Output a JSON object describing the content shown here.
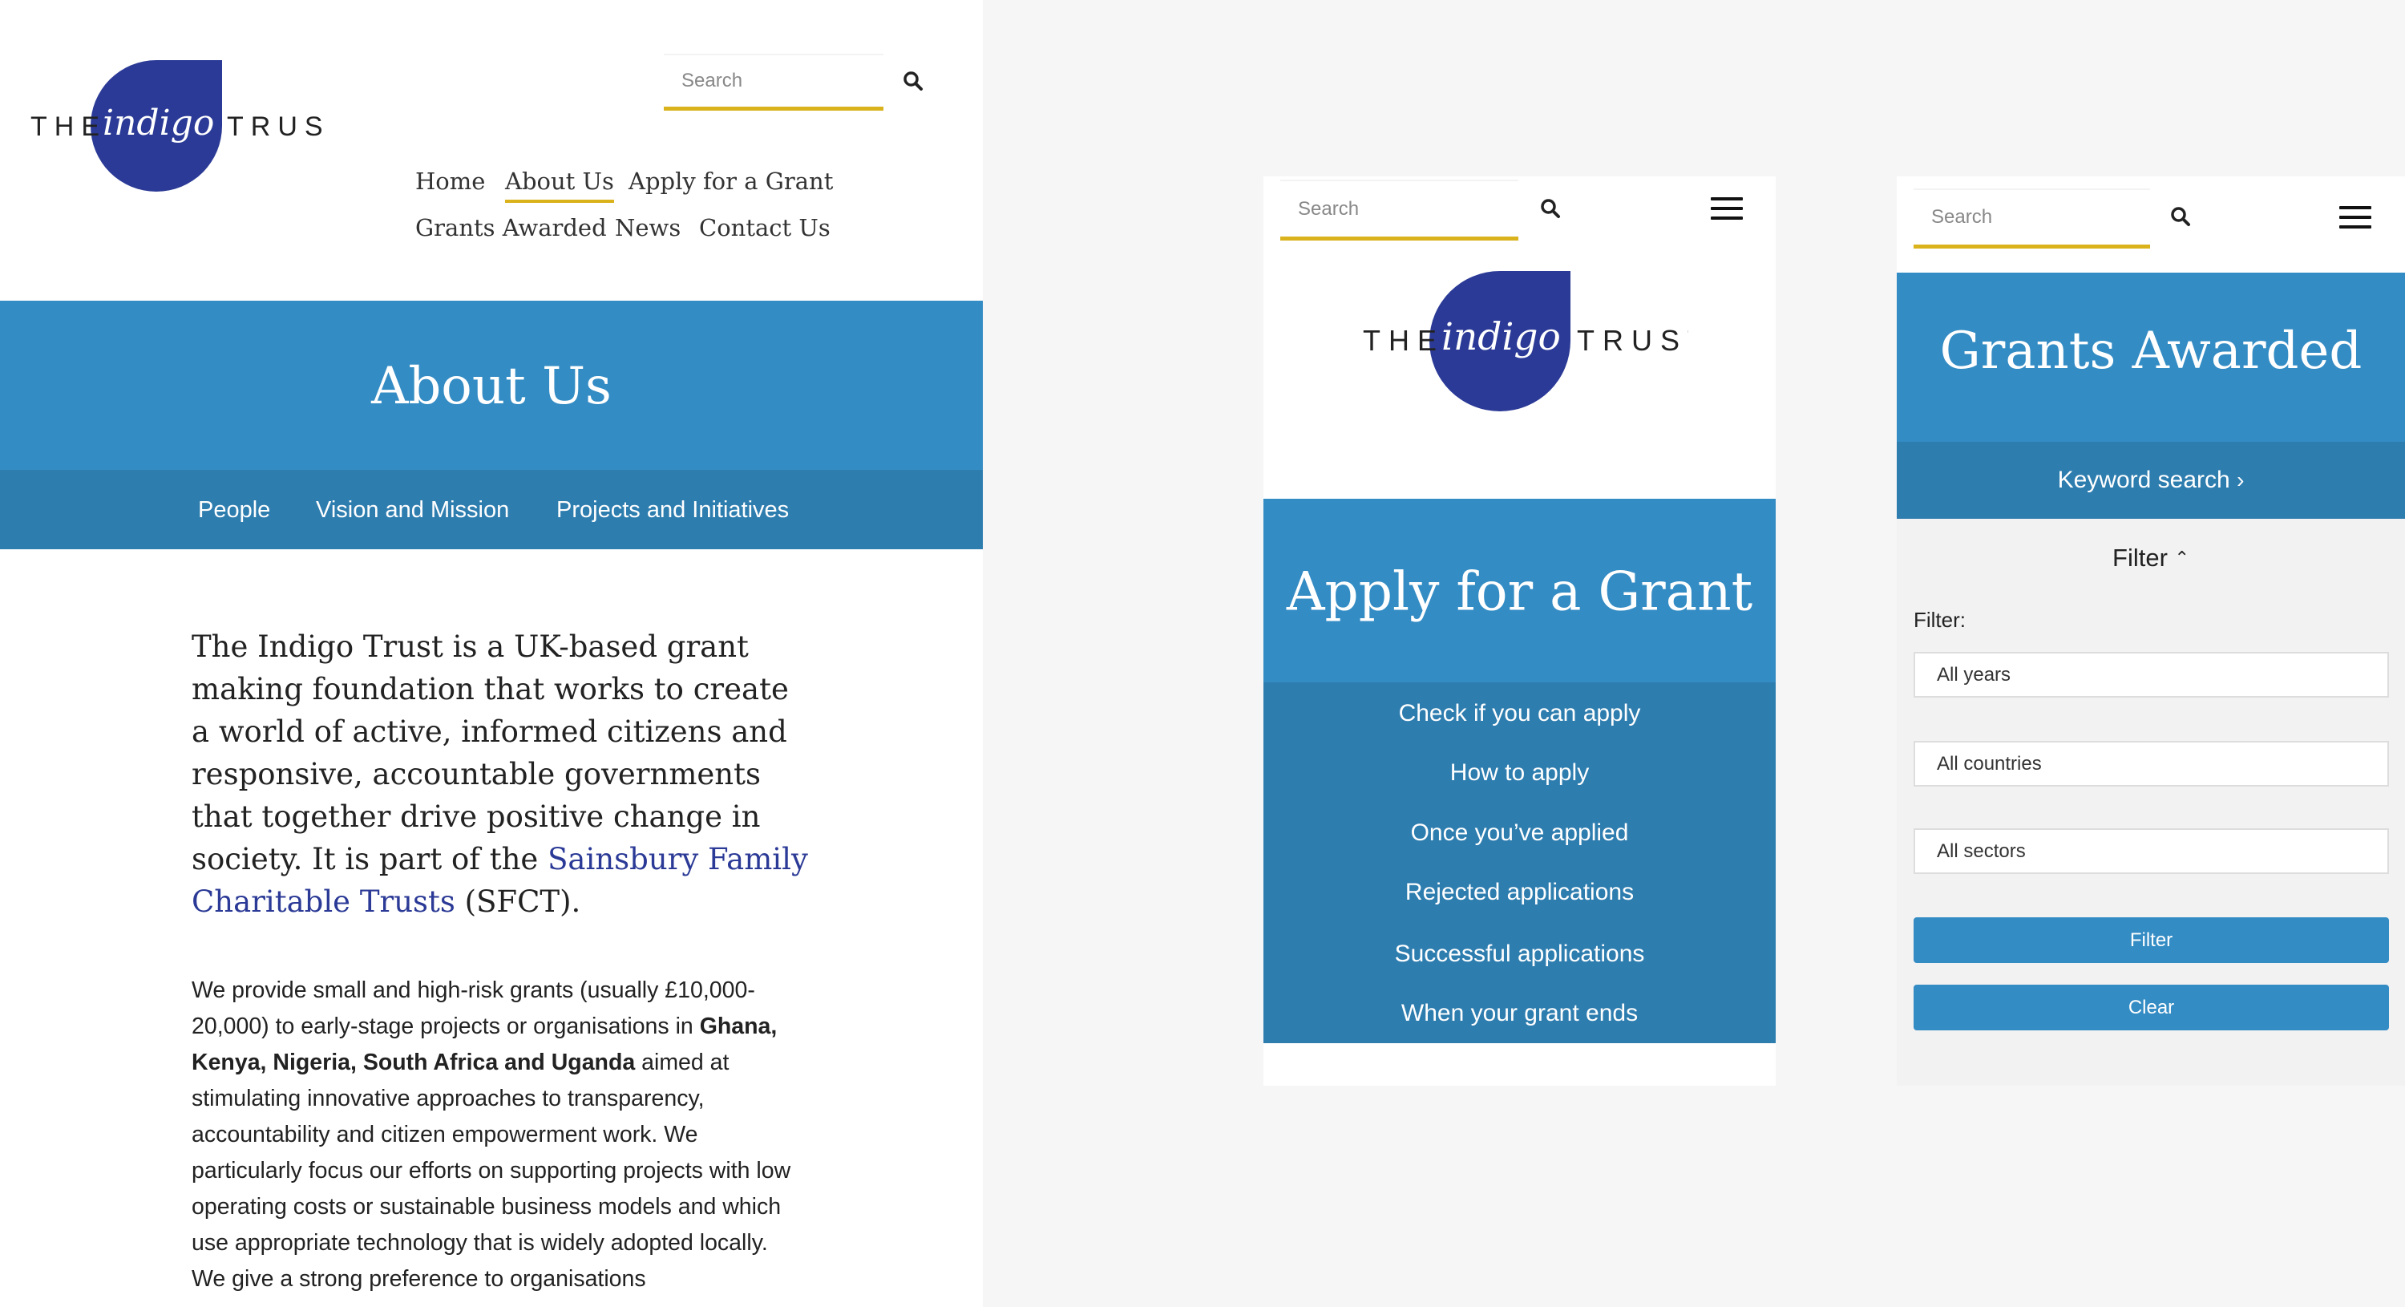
{
  "logo": {
    "the": "THE",
    "indigo": "indigo",
    "trust": "TRUST"
  },
  "colors": {
    "brand_blue": "#348cc4",
    "dark_blue": "#2e7daf",
    "accent": "#d9b21c",
    "logo": "#2b3a96"
  },
  "left": {
    "search_placeholder": "Search",
    "nav": [
      "Home",
      "About Us",
      "Apply for a Grant",
      "Grants Awarded",
      "News",
      "Contact Us"
    ],
    "title": "About Us",
    "subnav": [
      "People",
      "Vision and Mission",
      "Projects and Initiatives"
    ],
    "intro_a": "The Indigo Trust is a UK-based grant making foundation that works to create a world of active, informed citizens and responsive, accountable governments that together drive positive change in society. It is part of the ",
    "intro_link": "Sainsbury Family Charitable Trusts",
    "intro_b": " (SFCT).",
    "body_a": "We provide small and high-risk grants (usually £10,000-20,000) to early-stage projects or organisations in ",
    "body_bold": "Ghana, Kenya, Nigeria, South Africa and Uganda",
    "body_b": " aimed at stimulating innovative approaches to transparency, accountability and citizen empowerment work. We particularly focus our efforts on supporting projects with low operating costs or sustainable business models and which use appropriate technology that is widely adopted locally.  We give a strong preference to organisations"
  },
  "middle": {
    "search_placeholder": "Search",
    "title": "Apply for a Grant",
    "items": [
      "Check if you can apply",
      "How to apply",
      "Once you’ve applied",
      "Rejected applications",
      "Successful applications",
      "When your grant ends"
    ]
  },
  "right": {
    "search_placeholder": "Search",
    "title": "Grants Awarded",
    "keyword": "Keyword search",
    "filter_toggle": "Filter",
    "filter_label": "Filter:",
    "selects": [
      "All years",
      "All countries",
      "All sectors"
    ],
    "filter_button": "Filter",
    "clear_button": "Clear"
  }
}
